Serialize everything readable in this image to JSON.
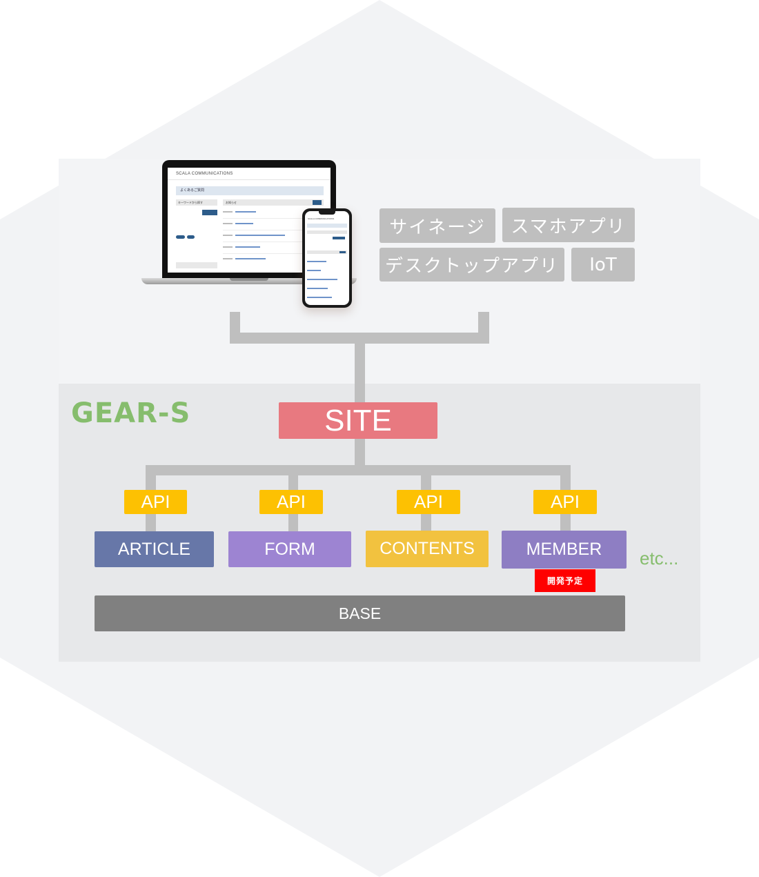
{
  "colors": {
    "hexagon_bg": "#f2f3f5",
    "gear_panel_bg": "#e7e8ea",
    "connector": "#bfbfbf",
    "platform_tag": "#bfbfbf",
    "gear_label": "#86bd6d",
    "site": "#e87980",
    "api": "#fdc102",
    "article": "#6777a8",
    "form": "#9d84d2",
    "contents": "#f2c23f",
    "member": "#8e7ec3",
    "planned_badge": "#ff0000",
    "base": "#808080"
  },
  "devices": {
    "laptop_screen": {
      "logo_text": "SCALA COMMUNICATIONS",
      "page_title": "よくあるご質問",
      "search_heading": "キーワードから探す",
      "news_heading": "お知らせ"
    },
    "phone_screen": {
      "logo_text": "SCALA COMMUNICATIONS",
      "page_title": "よくあるご質問"
    }
  },
  "platforms": [
    {
      "label": "サイネージ"
    },
    {
      "label": "スマホアプリ"
    },
    {
      "label": "デスクトップアプリ"
    },
    {
      "label": "IoT"
    }
  ],
  "gear": {
    "label": "GEAR-S",
    "site_label": "SITE",
    "modules": [
      {
        "api_label": "API",
        "label": "ARTICLE"
      },
      {
        "api_label": "API",
        "label": "FORM"
      },
      {
        "api_label": "API",
        "label": "CONTENTS"
      },
      {
        "api_label": "API",
        "label": "MEMBER",
        "badge": "開発予定"
      }
    ],
    "etc_label": "etc...",
    "base_label": "BASE"
  }
}
